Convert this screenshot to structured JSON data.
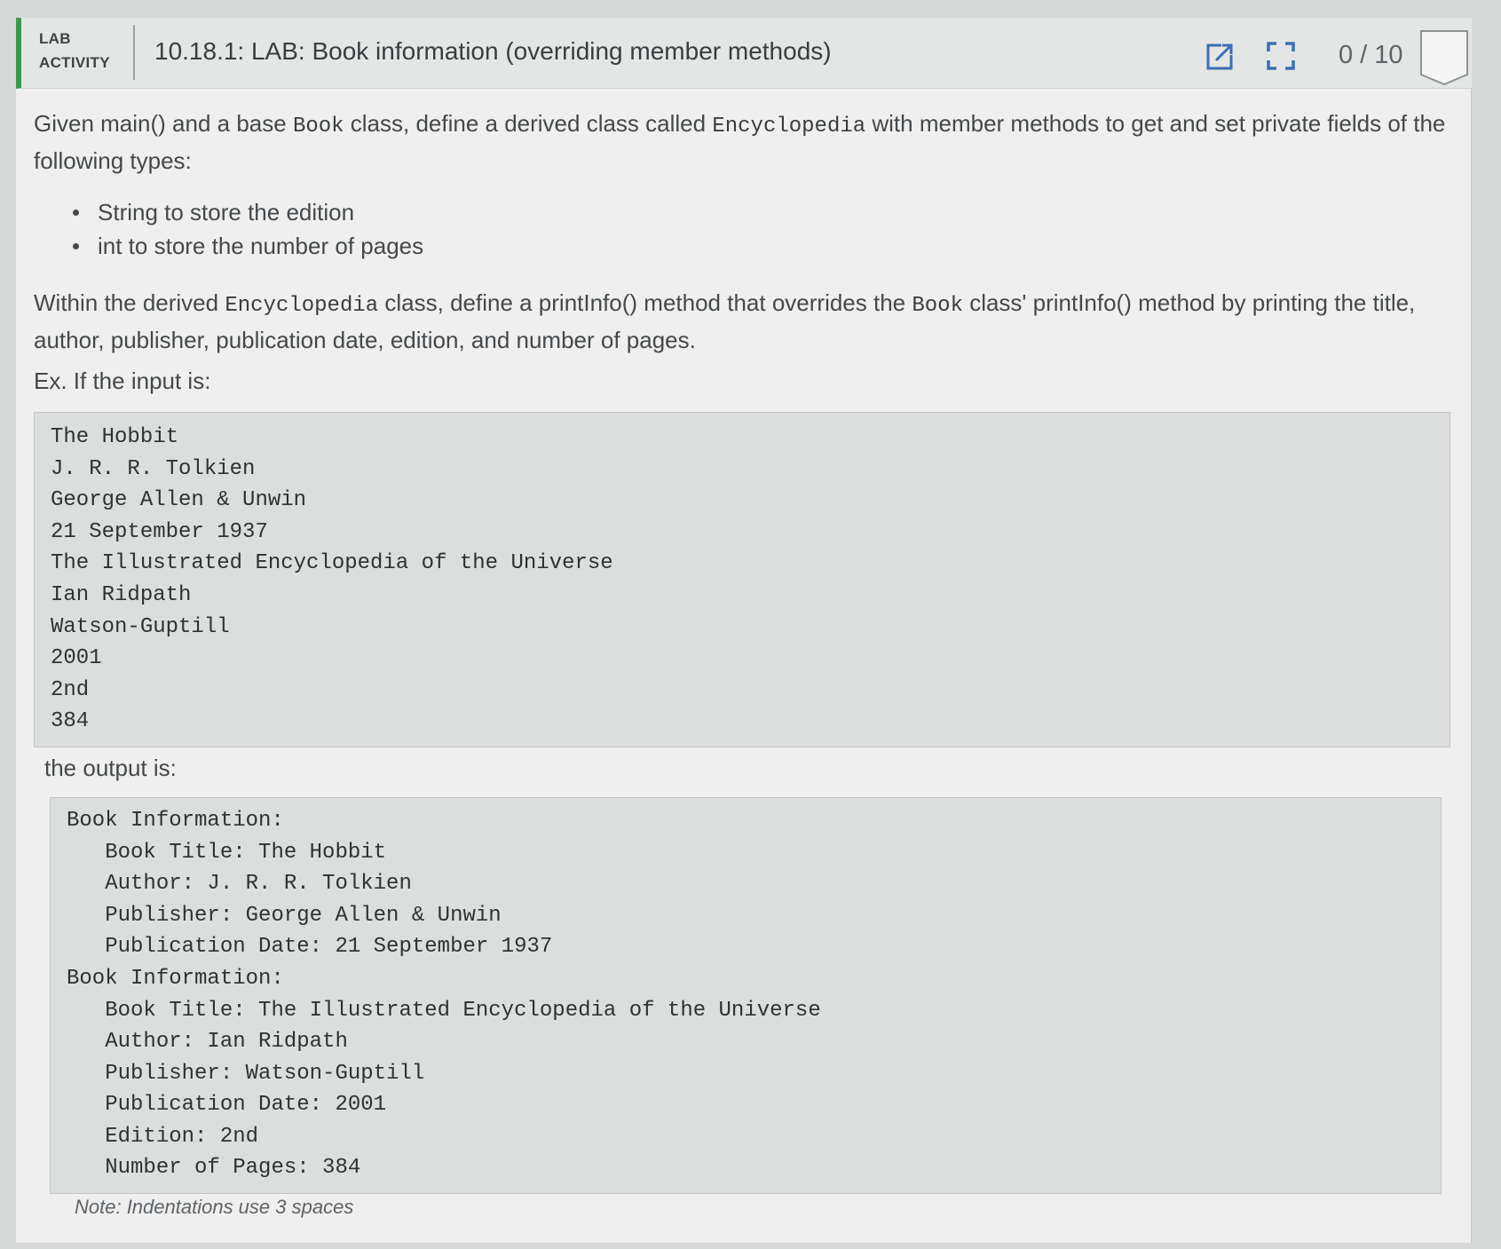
{
  "header": {
    "tag_line1": "LAB",
    "tag_line2": "ACTIVITY",
    "title": "10.18.1: LAB: Book information (overriding member methods)",
    "score": "0 / 10",
    "open_icon": "open-in-new-icon",
    "fullscreen_icon": "fullscreen-icon",
    "accent_color": "#3a9a4c",
    "icon_color": "#3b6fb6"
  },
  "intro": {
    "p1_a": "Given main() and a base ",
    "p1_code1": "Book",
    "p1_b": " class, define a derived class called ",
    "p1_code2": "Encyclopedia",
    "p1_c": " with member methods to get and set private fields of the following types:",
    "bullets": [
      "String to store the edition",
      "int to store the number of pages"
    ],
    "p2_a": "Within the derived ",
    "p2_code1": "Encyclopedia",
    "p2_b": " class, define a printInfo() method that overrides the ",
    "p2_code2": "Book",
    "p2_c": " class' printInfo() method by printing the title, author, publisher, publication date, edition, and number of pages.",
    "p3": "Ex. If the input is:"
  },
  "input_lines": [
    "The Hobbit",
    "J. R. R. Tolkien",
    "George Allen & Unwin",
    "21 September 1937",
    "The Illustrated Encyclopedia of the Universe",
    "Ian Ridpath",
    "Watson-Guptill",
    "2001",
    "2nd",
    "384"
  ],
  "output_label": "the output is:",
  "output_lines": [
    "Book Information:",
    "   Book Title: The Hobbit",
    "   Author: J. R. R. Tolkien",
    "   Publisher: George Allen & Unwin",
    "   Publication Date: 21 September 1937",
    "Book Information:",
    "   Book Title: The Illustrated Encyclopedia of the Universe",
    "   Author: Ian Ridpath",
    "   Publisher: Watson-Guptill",
    "   Publication Date: 2001",
    "   Edition: 2nd",
    "   Number of Pages: 384"
  ],
  "note": "Note: Indentations use 3 spaces"
}
